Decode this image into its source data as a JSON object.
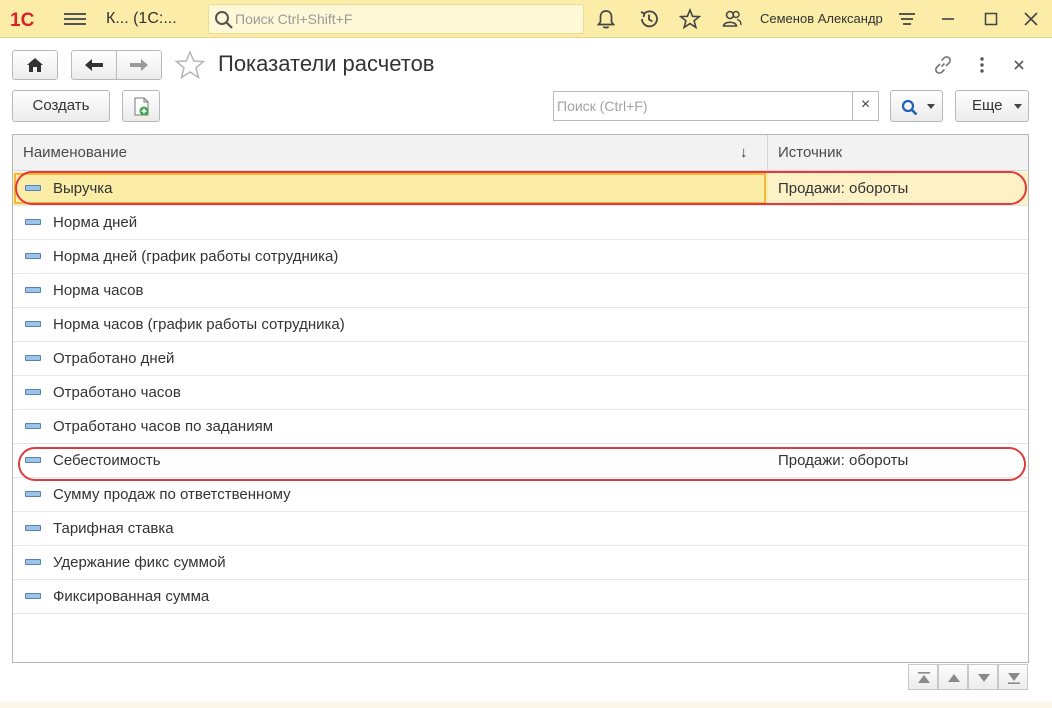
{
  "app": {
    "logo_text": "1С",
    "title": "К... (1С:...",
    "search_placeholder": "Поиск Ctrl+Shift+F",
    "user_name": "Семенов Александр"
  },
  "window": {
    "title": "Показатели расчетов"
  },
  "toolbar": {
    "create_label": "Создать",
    "search_placeholder": "Поиск (Ctrl+F)",
    "search_clear": "×",
    "more_label": "Еще"
  },
  "table": {
    "columns": [
      "Наименование",
      "Источник"
    ],
    "sort_indicator": "↓",
    "rows": [
      {
        "name": "Выручка",
        "source": "Продажи: обороты"
      },
      {
        "name": "Норма дней",
        "source": ""
      },
      {
        "name": "Норма дней (график работы сотрудника)",
        "source": ""
      },
      {
        "name": "Норма часов",
        "source": ""
      },
      {
        "name": "Норма часов (график работы сотрудника)",
        "source": ""
      },
      {
        "name": "Отработано дней",
        "source": ""
      },
      {
        "name": "Отработано часов",
        "source": ""
      },
      {
        "name": "Отработано часов по заданиям",
        "source": ""
      },
      {
        "name": "Себестоимость",
        "source": "Продажи: обороты"
      },
      {
        "name": "Сумму продаж по ответственному",
        "source": ""
      },
      {
        "name": "Тарифная ставка",
        "source": ""
      },
      {
        "name": "Удержание фикс суммой",
        "source": ""
      },
      {
        "name": "Фиксированная сумма",
        "source": ""
      }
    ],
    "selected_row_index": 0
  },
  "colors": {
    "appbar": "#fbeda8",
    "selection": "#fbeca6",
    "highlight_circle": "#e0393e",
    "logo": "#d9232a"
  }
}
